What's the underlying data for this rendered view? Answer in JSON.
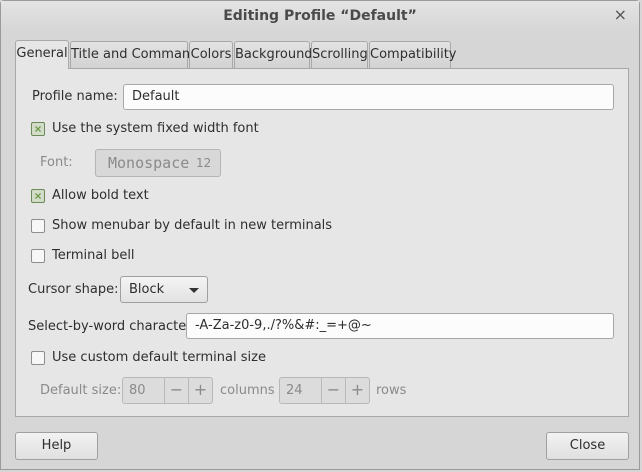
{
  "window": {
    "title": "Editing Profile “Default”",
    "close_glyph": "×"
  },
  "tabs": [
    "General",
    "Title and Command",
    "Colors",
    "Background",
    "Scrolling",
    "Compatibility"
  ],
  "general": {
    "profile_name_label": "Profile name:",
    "profile_name_value": "Default",
    "system_font_label": "Use the system fixed width font",
    "system_font_checked": true,
    "font_label": "Font:",
    "font_name": "Monospace",
    "font_size": "12",
    "bold_label": "Allow bold text",
    "bold_checked": true,
    "menubar_label": "Show menubar by default in new terminals",
    "menubar_checked": false,
    "bell_label": "Terminal bell",
    "bell_checked": false,
    "cursor_label": "Cursor shape:",
    "cursor_value": "Block",
    "select_word_label": "Select-by-word characters:",
    "select_word_value": "-A-Za-z0-9,./?%&#:_=+@~",
    "custom_size_label": "Use custom default terminal size",
    "custom_size_checked": false,
    "default_size_label": "Default size:",
    "columns_value": "80",
    "columns_label": "columns",
    "rows_value": "24",
    "rows_label": "rows",
    "minus_glyph": "−",
    "plus_glyph": "+"
  },
  "footer": {
    "help_label": "Help",
    "close_label": "Close"
  },
  "colors": {
    "check_accent": "#6e9a4a",
    "background": "#d6d6d6",
    "panel": "#e6e6e6"
  }
}
